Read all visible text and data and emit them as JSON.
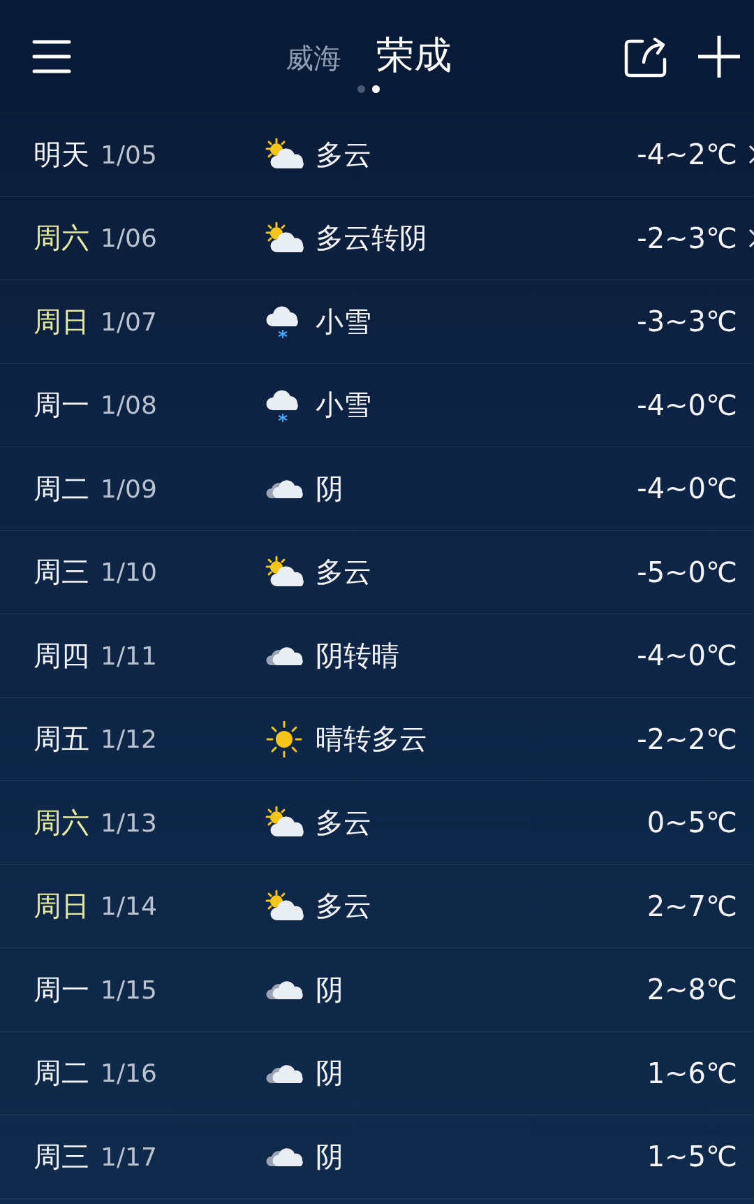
{
  "header": {
    "cities": [
      {
        "name": "威海",
        "selected": false
      },
      {
        "name": "荣成",
        "selected": true
      }
    ],
    "pages": [
      {
        "selected": false
      },
      {
        "selected": true
      }
    ]
  },
  "forecast": [
    {
      "day": "明天",
      "weekend": false,
      "date": "1/05",
      "kind": "partly_cloudy",
      "condition": "多云",
      "temp": "-4~2℃",
      "detail": true
    },
    {
      "day": "周六",
      "weekend": true,
      "date": "1/06",
      "kind": "partly_cloudy",
      "condition": "多云转阴",
      "temp": "-2~3℃",
      "detail": true
    },
    {
      "day": "周日",
      "weekend": true,
      "date": "1/07",
      "kind": "snow",
      "condition": "小雪",
      "temp": "-3~3℃",
      "detail": false
    },
    {
      "day": "周一",
      "weekend": false,
      "date": "1/08",
      "kind": "snow",
      "condition": "小雪",
      "temp": "-4~0℃",
      "detail": false
    },
    {
      "day": "周二",
      "weekend": false,
      "date": "1/09",
      "kind": "cloudy",
      "condition": "阴",
      "temp": "-4~0℃",
      "detail": false
    },
    {
      "day": "周三",
      "weekend": false,
      "date": "1/10",
      "kind": "partly_cloudy",
      "condition": "多云",
      "temp": "-5~0℃",
      "detail": false
    },
    {
      "day": "周四",
      "weekend": false,
      "date": "1/11",
      "kind": "cloudy",
      "condition": "阴转晴",
      "temp": "-4~0℃",
      "detail": false
    },
    {
      "day": "周五",
      "weekend": false,
      "date": "1/12",
      "kind": "sunny",
      "condition": "晴转多云",
      "temp": "-2~2℃",
      "detail": false
    },
    {
      "day": "周六",
      "weekend": true,
      "date": "1/13",
      "kind": "partly_cloudy",
      "condition": "多云",
      "temp": "0~5℃",
      "detail": false
    },
    {
      "day": "周日",
      "weekend": true,
      "date": "1/14",
      "kind": "partly_cloudy",
      "condition": "多云",
      "temp": "2~7℃",
      "detail": false
    },
    {
      "day": "周一",
      "weekend": false,
      "date": "1/15",
      "kind": "cloudy",
      "condition": "阴",
      "temp": "2~8℃",
      "detail": false
    },
    {
      "day": "周二",
      "weekend": false,
      "date": "1/16",
      "kind": "cloudy",
      "condition": "阴",
      "temp": "1~6℃",
      "detail": false
    },
    {
      "day": "周三",
      "weekend": false,
      "date": "1/17",
      "kind": "cloudy",
      "condition": "阴",
      "temp": "1~5℃",
      "detail": false
    }
  ]
}
